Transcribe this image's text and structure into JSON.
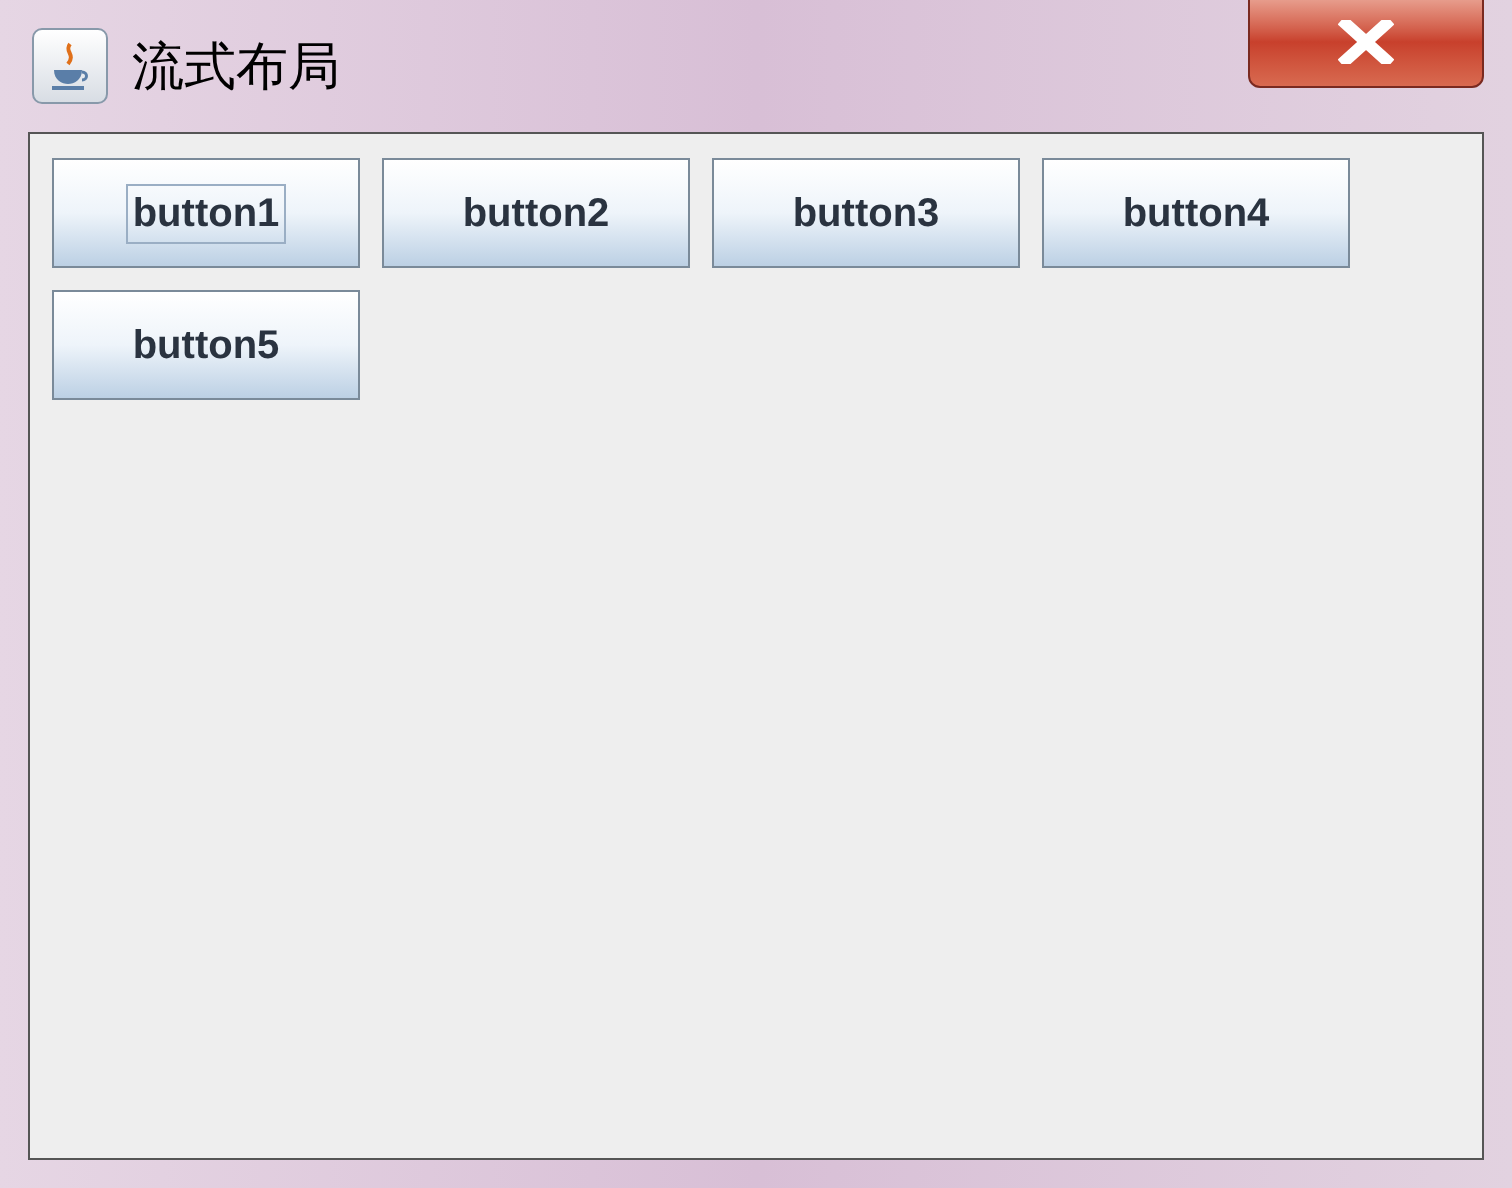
{
  "window": {
    "title": "流式布局"
  },
  "buttons": [
    {
      "label": "button1",
      "focused": true
    },
    {
      "label": "button2",
      "focused": false
    },
    {
      "label": "button3",
      "focused": false
    },
    {
      "label": "button4",
      "focused": false
    },
    {
      "label": "button5",
      "focused": false
    }
  ]
}
